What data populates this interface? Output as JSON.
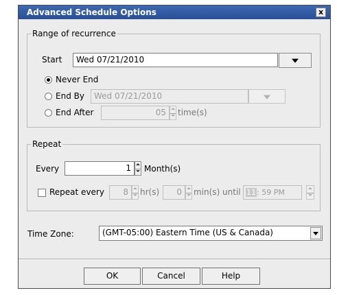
{
  "dialog": {
    "title": "Advanced Schedule Options",
    "close_label": "x"
  },
  "recurrence": {
    "group_label": "Range of recurrence",
    "start_label": "Start",
    "start_value": "Wed 07/21/2010",
    "options": [
      {
        "label": "Never End",
        "selected": true
      },
      {
        "label": "End By",
        "selected": false
      },
      {
        "label": "End After",
        "selected": false
      }
    ],
    "end_by_value": "Wed 07/21/2010",
    "end_after_value": "05",
    "end_after_unit": "time(s)"
  },
  "repeat": {
    "group_label": "Repeat",
    "every_label": "Every",
    "every_value": "1",
    "every_unit": "Month(s)",
    "repeat_every_label": "Repeat every",
    "repeat_every_checked": false,
    "hr_value": "8",
    "hr_unit": "hr(s)",
    "min_value": "0",
    "min_unit": "min(s) until",
    "until_hour": "11",
    "until_rest": ": 59 PM"
  },
  "timezone": {
    "label": "Time Zone:",
    "value": "(GMT-05:00) Eastern Time (US & Canada)"
  },
  "buttons": {
    "ok": "OK",
    "cancel": "Cancel",
    "help": "Help"
  }
}
